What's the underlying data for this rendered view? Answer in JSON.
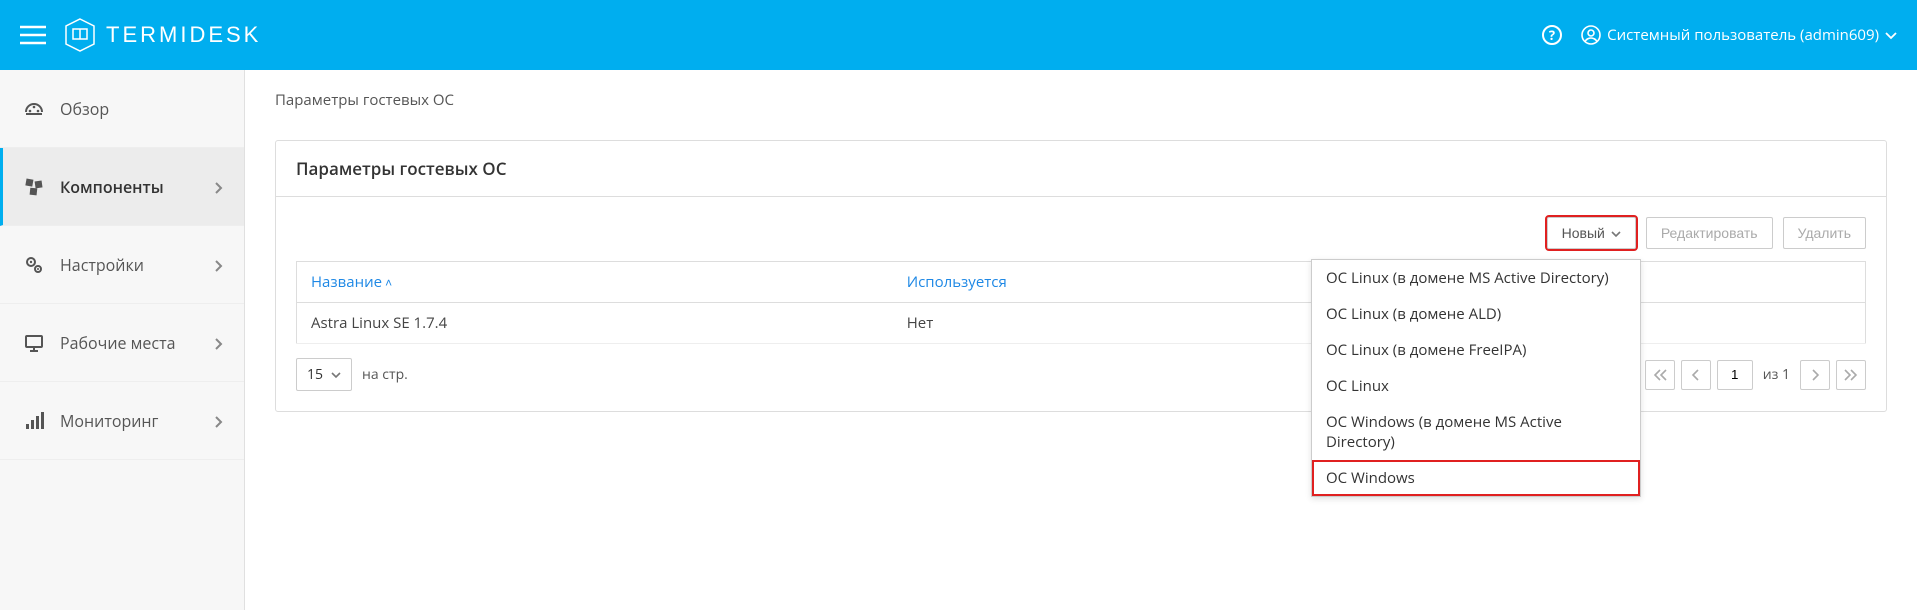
{
  "header": {
    "brand": "TERMIDESK",
    "user_label": "Системный пользователь (admin609)"
  },
  "sidebar": {
    "items": [
      {
        "label": "Обзор"
      },
      {
        "label": "Компоненты"
      },
      {
        "label": "Настройки"
      },
      {
        "label": "Рабочие места"
      },
      {
        "label": "Мониторинг"
      }
    ]
  },
  "breadcrumb": "Параметры гостевых ОС",
  "panel": {
    "title": "Параметры гостевых ОС"
  },
  "toolbar": {
    "new": "Новый",
    "edit": "Редактировать",
    "delete": "Удалить"
  },
  "table": {
    "columns": {
      "name": "Название",
      "used": "Используется"
    },
    "rows": [
      {
        "name": "Astra Linux SE 1.7.4",
        "used": "Нет"
      }
    ]
  },
  "footer": {
    "page_size": "15",
    "page_label": "на стр.",
    "page_current": "1",
    "page_of": "из 1"
  },
  "dropdown": {
    "items": [
      "ОС Linux (в домене MS Active Directory)",
      "ОС Linux (в домене ALD)",
      "ОС Linux (в домене FreeIPA)",
      "ОС Linux",
      "ОС Windows (в домене MS Active Directory)",
      "ОС Windows"
    ]
  }
}
